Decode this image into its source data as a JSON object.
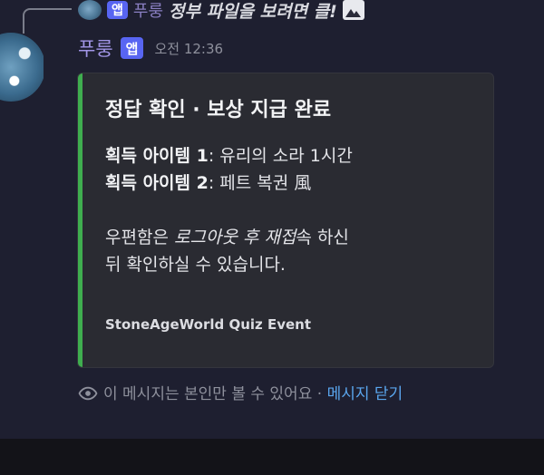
{
  "reply": {
    "app_badge": "앱",
    "username": "푸룽",
    "text": "정부 파일을 보려면 클!",
    "attachment_icon": "image-icon"
  },
  "message": {
    "username": "푸룽",
    "app_badge": "앱",
    "timestamp": "오전 12:36"
  },
  "embed": {
    "accent_color": "#3fae4f",
    "title": "정답 확인 · 보상 지급 완료",
    "item1_label": "획득 아이템 1",
    "item1_value": ": 유리의 소라 1시간",
    "item2_label": "획득 아이템 2",
    "item2_value": ": 페트 복권 風",
    "notice_prefix": "우편함은 ",
    "notice_emphasis": "로그아웃 후 재접",
    "notice_suffix": "속 하신",
    "notice_line2": "뒤 확인하실 수 있습니다.",
    "footer": "StoneAgeWorld Quiz Event"
  },
  "ephemeral": {
    "icon": "eye-icon",
    "text": "이 메시지는 본인만 볼 수 있어요 · ",
    "dismiss_label": "메시지 닫기"
  }
}
